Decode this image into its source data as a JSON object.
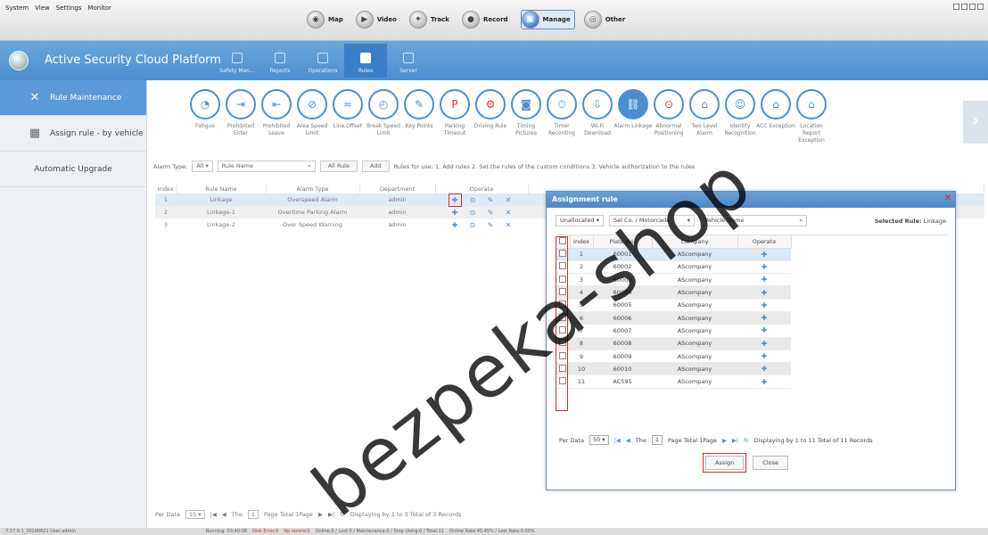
{
  "menu": [
    "System",
    "View",
    "Settings",
    "Monitor"
  ],
  "modules": [
    {
      "label": "Map",
      "icon": "map-icon",
      "active": false
    },
    {
      "label": "Video",
      "icon": "video-icon",
      "active": false
    },
    {
      "label": "Track",
      "icon": "track-icon",
      "active": false
    },
    {
      "label": "Record",
      "icon": "record-icon",
      "active": false
    },
    {
      "label": "Manage",
      "icon": "manage-icon",
      "active": true
    },
    {
      "label": "Other",
      "icon": "other-icon",
      "active": false
    }
  ],
  "app": {
    "title": "Active Security Cloud Platform"
  },
  "header_tabs": [
    {
      "label": "Safety Man..."
    },
    {
      "label": "Reports"
    },
    {
      "label": "Operations"
    },
    {
      "label": "Rules",
      "active": true
    },
    {
      "label": "Server"
    }
  ],
  "sidebar": [
    {
      "label": "Rule Maintenance",
      "icon": "wrench-icon",
      "active": true
    },
    {
      "label": "Assign rule - by vehicle",
      "icon": "vehicle-icon"
    },
    {
      "label": "Automatic Upgrade"
    }
  ],
  "rule_icons": [
    {
      "label": "Fatigue"
    },
    {
      "label": "Prohibited Enter"
    },
    {
      "label": "Prohibited Leave"
    },
    {
      "label": "Area Speed Limit"
    },
    {
      "label": "Line Offset"
    },
    {
      "label": "Break Speed Limit"
    },
    {
      "label": "Key Points"
    },
    {
      "label": "Parking Timeout"
    },
    {
      "label": "Driving Rule"
    },
    {
      "label": "Timing Pictures"
    },
    {
      "label": "Timer Recording"
    },
    {
      "label": "Wi-Fi Download"
    },
    {
      "label": "Alarm Linkage",
      "active": true
    },
    {
      "label": "Abnormal Positioning"
    },
    {
      "label": "Two Level Alarm"
    },
    {
      "label": "Identity Recognition"
    },
    {
      "label": "ACC Exception"
    },
    {
      "label": "Location Report Exception"
    }
  ],
  "toolbar": {
    "alarm_type_label": "Alarm Type:",
    "alarm_type_value": "All",
    "rule_name_placeholder": "Rule Name",
    "all_rule_button": "All Rule",
    "add_button": "Add",
    "hint": "Rules for use: 1. Add rules 2. Set the rules of the custom conditions 3. Vehicle authorization to the rules"
  },
  "rule_table": {
    "headers": [
      "Index",
      "Rule Name",
      "Alarm Type",
      "Department",
      "Operate"
    ],
    "rows": [
      {
        "index": "1",
        "name": "Linkage",
        "type": "Overspeed Alarm",
        "dept": "admin"
      },
      {
        "index": "2",
        "name": "Linkage-1",
        "type": "Overtime Parking Alarm",
        "dept": "admin"
      },
      {
        "index": "3",
        "name": "Linkage-2",
        "type": "Over Speed Warning",
        "dept": "admin"
      }
    ]
  },
  "pager": {
    "per_label": "Per Data",
    "per_value": "15",
    "the": "The",
    "page_value": "1",
    "page_total": "Page Total 1Page",
    "display": "Displaying by 1 to 3 Total of 3 Records"
  },
  "status": {
    "version": "7.17.0.1_20190621  User:admin",
    "running": "Running: 03:40:08",
    "disk": "Disk Error:0",
    "no_record": "No record:0",
    "counts": "Online:5 / Lost:0 / Maintenance:0 / Stop Using:0 / Total:11",
    "rates": "Online Rate:45.45% / Lost Rate:0.00%"
  },
  "dialog": {
    "title": "Assignment rule",
    "filter_value": "Unallocated",
    "company_value": "Sel Co. / Motorcade",
    "vehicle_placeholder": "Vehicle Name",
    "selected_rule_label": "Selected Rule:",
    "selected_rule_value": "Linkage",
    "headers": [
      "Index",
      "Plate No.",
      "Company",
      "Operate"
    ],
    "rows": [
      {
        "index": "1",
        "plate": "60001",
        "company": "AScompany"
      },
      {
        "index": "2",
        "plate": "60002",
        "company": "AScompany"
      },
      {
        "index": "3",
        "plate": "60003",
        "company": "AScompany"
      },
      {
        "index": "4",
        "plate": "60004",
        "company": "AScompany"
      },
      {
        "index": "5",
        "plate": "60005",
        "company": "AScompany"
      },
      {
        "index": "6",
        "plate": "60006",
        "company": "AScompany"
      },
      {
        "index": "7",
        "plate": "60007",
        "company": "AScompany"
      },
      {
        "index": "8",
        "plate": "60008",
        "company": "AScompany"
      },
      {
        "index": "9",
        "plate": "60009",
        "company": "AScompany"
      },
      {
        "index": "10",
        "plate": "60010",
        "company": "AScompany"
      },
      {
        "index": "11",
        "plate": "AC595",
        "company": "AScompany"
      }
    ],
    "pager": {
      "per_label": "Per Data",
      "per_value": "50",
      "the": "The",
      "page_value": "1",
      "page_total": "Page Total 1Page",
      "display": "Displaying by 1 to 11 Total of 11 Records"
    },
    "assign_button": "Assign",
    "close_button": "Close"
  },
  "watermark": "bezpeka-shop"
}
